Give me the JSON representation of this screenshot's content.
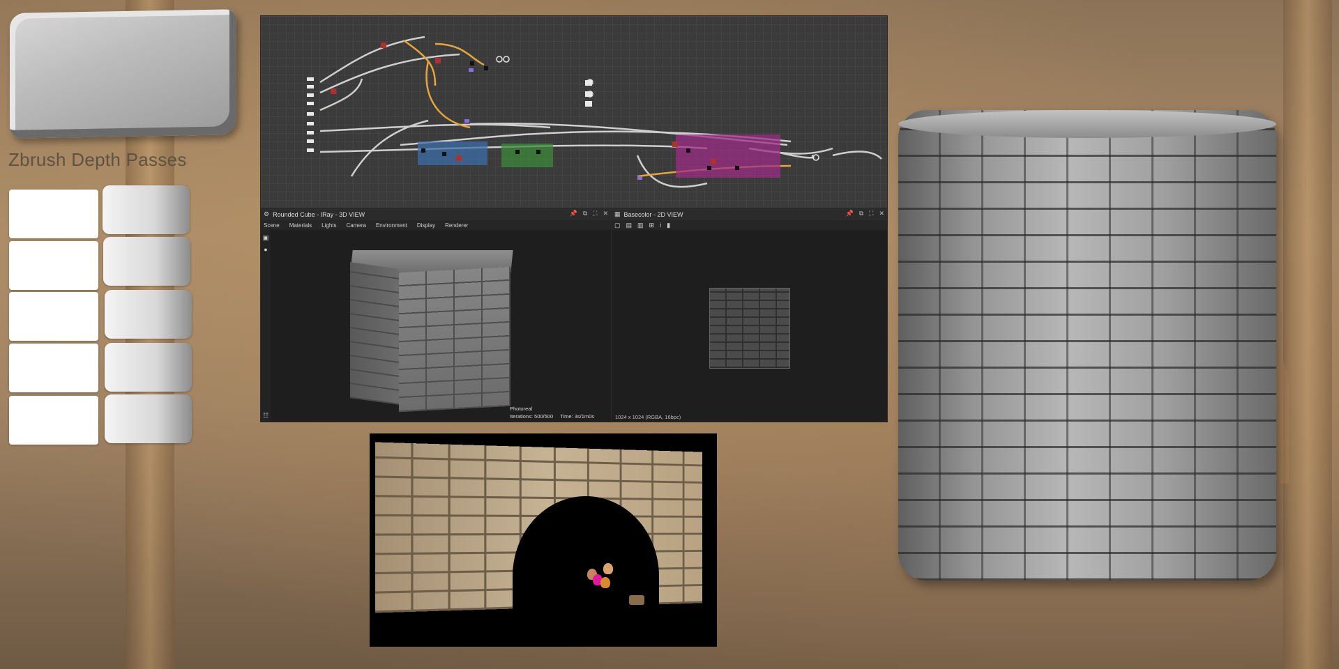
{
  "left_panel": {
    "title": "Zbrush Depth Passes"
  },
  "view3d": {
    "title": "Rounded Cube - IRay - 3D VIEW",
    "menu": [
      "Scene",
      "Materials",
      "Lights",
      "Camera",
      "Environment",
      "Display",
      "Renderer"
    ],
    "status_mode": "Photoreal",
    "status_iterations": "Iterations: 500/500",
    "status_time": "Time: 3s/1m0s"
  },
  "view2d": {
    "title": "Basecolor - 2D VIEW",
    "info": "1024 x 1024 (RGBA, 16bpc)"
  },
  "icons": {
    "pin": "📌",
    "float": "⧉",
    "maximize": "⛶",
    "close": "✕",
    "view3d": "⚙",
    "view2d": "▦",
    "camera": "▣",
    "light": "●",
    "grid": "☷"
  }
}
